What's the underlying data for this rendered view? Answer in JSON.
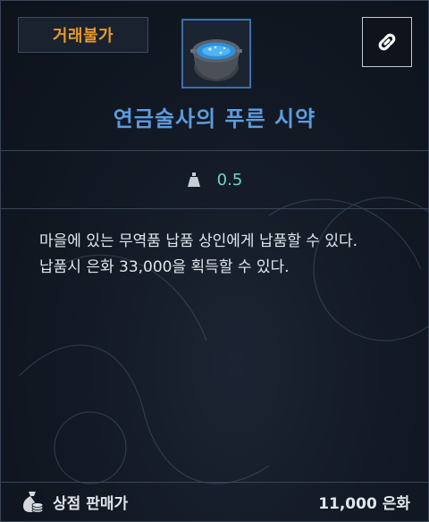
{
  "header": {
    "badge_label": "거래불가",
    "item_name": "연금술사의 푸른 시약",
    "icons": {
      "item": "potion-pot-icon",
      "link": "link-icon"
    }
  },
  "weight": {
    "icon": "weight-icon",
    "value": "0.5"
  },
  "description": {
    "line1": "마을에 있는 무역품 납품 상인에게 납품할 수 있다.",
    "line2": "납품시 은화 33,000을 획득할 수 있다."
  },
  "footer": {
    "icon": "coin-bag-icon",
    "label": "상점 판매가",
    "price": "11,000 은화"
  },
  "colors": {
    "badge_text": "#e39a2a",
    "title": "#5d9be0",
    "weight_value": "#6fd3c8",
    "icon_border": "#3c6fb0"
  }
}
